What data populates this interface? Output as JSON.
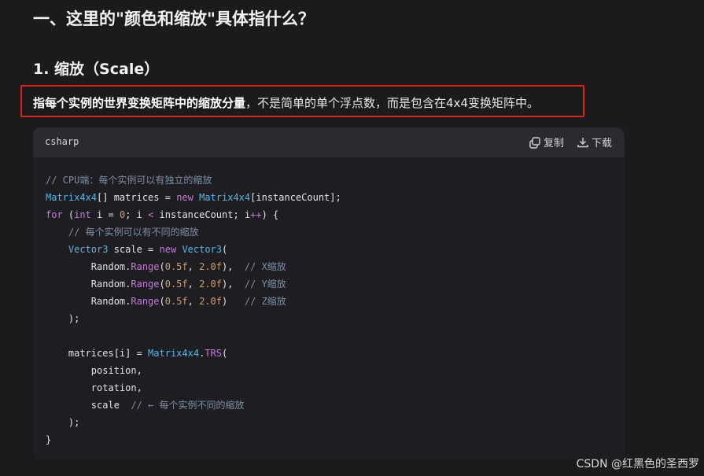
{
  "heading": "一、这里的\"颜色和缩放\"具体指什么？",
  "subheading": "1. 缩放（Scale）",
  "paragraph": {
    "bold": "指每个实例的世界变换矩阵中的缩放分量",
    "rest": "，不是简单的单个浮点数，而是包含在4x4变换矩阵中。"
  },
  "code_block": {
    "language": "csharp",
    "copy_label": "复制",
    "download_label": "下载",
    "lines": [
      "// CPU端：每个实例可以有独立的缩放",
      "Matrix4x4[] matrices = new Matrix4x4[instanceCount];",
      "for (int i = 0; i < instanceCount; i++) {",
      "    // 每个实例可以有不同的缩放",
      "    Vector3 scale = new Vector3(",
      "        Random.Range(0.5f, 2.0f),  // X缩放",
      "        Random.Range(0.5f, 2.0f),  // Y缩放",
      "        Random.Range(0.5f, 2.0f)   // Z缩放",
      "    );",
      "",
      "    matrices[i] = Matrix4x4.TRS(",
      "        position,",
      "        rotation,",
      "        scale  // ← 每个实例不同的缩放",
      "    );",
      "}"
    ]
  },
  "watermark": "CSDN @红黑色的圣西罗",
  "icons": {
    "copy": "copy-icon",
    "download": "download-icon"
  },
  "colors": {
    "background": "#1b1b1d",
    "highlight_border": "#e0201e",
    "code_bg": "#1e1e22",
    "code_header_bg": "#2a2a2f"
  }
}
